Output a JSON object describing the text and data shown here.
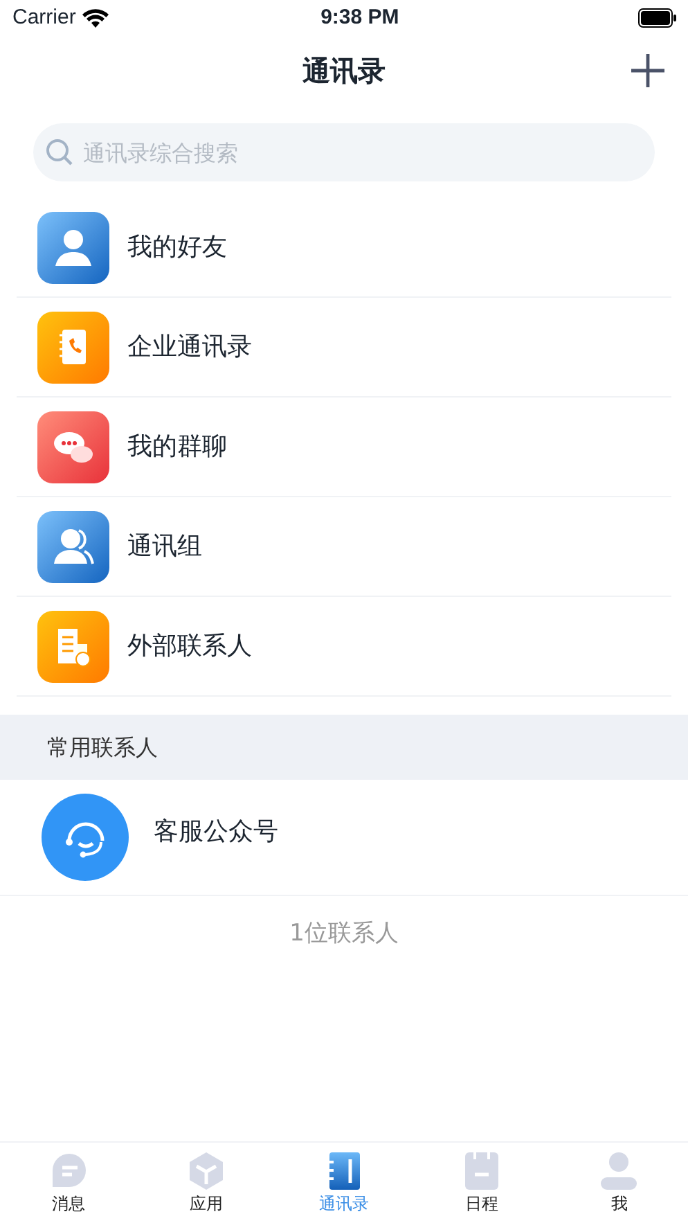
{
  "status_bar": {
    "carrier": "Carrier",
    "time": "9:38 PM"
  },
  "nav": {
    "title": "通讯录"
  },
  "search": {
    "placeholder": "通讯录综合搜索"
  },
  "menu": [
    {
      "kind": "friend",
      "label": "我的好友"
    },
    {
      "kind": "book",
      "label": "企业通讯录"
    },
    {
      "kind": "chat",
      "label": "我的群聊"
    },
    {
      "kind": "group",
      "label": "通讯组"
    },
    {
      "kind": "external",
      "label": "外部联系人"
    }
  ],
  "section": {
    "title": "常用联系人"
  },
  "contacts": [
    {
      "name": "客服公众号"
    }
  ],
  "contact_count": "1位联系人",
  "tabs": [
    {
      "kind": "message",
      "label": "消息",
      "selected": false
    },
    {
      "kind": "apps",
      "label": "应用",
      "selected": false
    },
    {
      "kind": "contacts",
      "label": "通讯录",
      "selected": true
    },
    {
      "kind": "schedule",
      "label": "日程",
      "selected": false
    },
    {
      "kind": "me",
      "label": "我",
      "selected": false
    }
  ]
}
